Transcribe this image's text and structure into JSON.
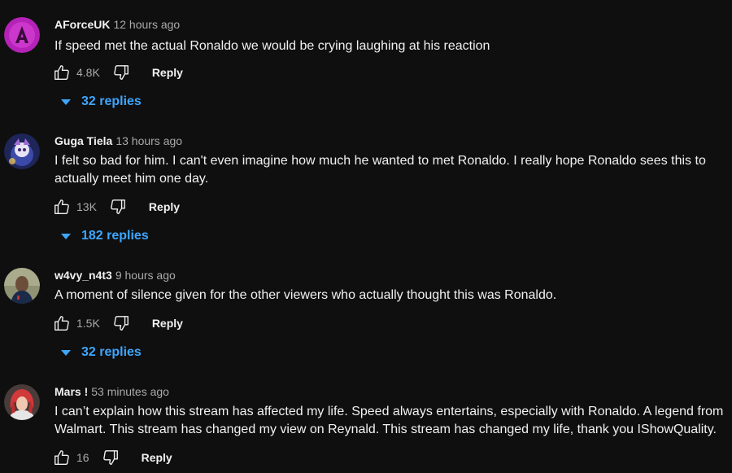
{
  "comments": [
    {
      "author": "AForceUK",
      "time": "12 hours ago",
      "text": "If speed met the actual Ronaldo we would be crying laughing at his reaction",
      "likes": "4.8K",
      "reply_label": "Reply",
      "replies_label": "32 replies",
      "avatar_color": "#c42bc4"
    },
    {
      "author": "Guga Tiela",
      "time": "13 hours ago",
      "text": "I felt so bad for him. I can't even imagine how much he wanted to met Ronaldo. I really hope Ronaldo sees this to actually meet him one day.",
      "likes": "13K",
      "reply_label": "Reply",
      "replies_label": "182 replies",
      "avatar_color": "#2a2f6b"
    },
    {
      "author": "w4vy_n4t3",
      "time": "9 hours ago",
      "text": "A moment of silence given for the other viewers who actually thought this was Ronaldo.",
      "likes": "1.5K",
      "reply_label": "Reply",
      "replies_label": "32 replies",
      "avatar_color": "#8a8e6a"
    },
    {
      "author": "Mars !",
      "time": "53 minutes ago",
      "text": "I can’t explain how this stream has affected my life. Speed always entertains, especially with Ronaldo. A legend from Walmart. This stream has changed my view on Reynald. This stream has changed my life, thank you  IShowQuality.",
      "likes": "16",
      "reply_label": "Reply",
      "avatar_color": "#5a4a4a"
    }
  ],
  "colors": {
    "background": "#0f0f0f",
    "text": "#f1f1f1",
    "secondary_text": "#aaaaaa",
    "link_blue": "#3ea6ff"
  },
  "icons": {
    "like": "thumbs-up-icon",
    "dislike": "thumbs-down-icon",
    "expand": "caret-down-icon"
  }
}
